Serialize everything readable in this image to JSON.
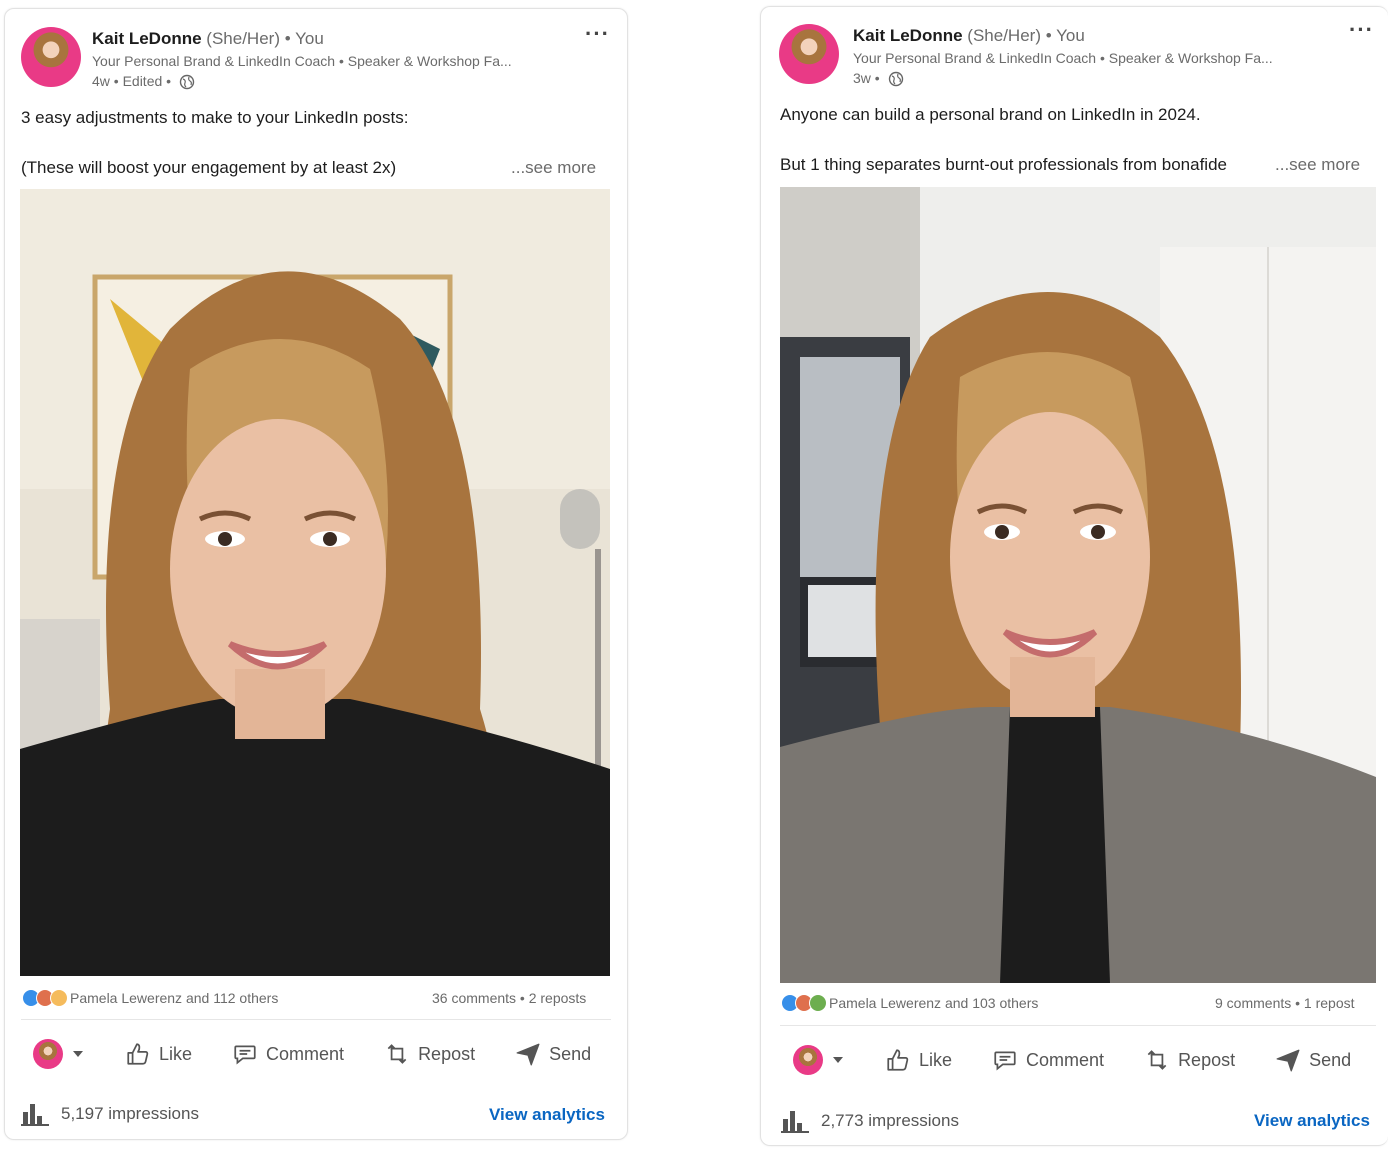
{
  "posts": [
    {
      "author": "Kait LeDonne",
      "pronouns": "(She/Her)",
      "relation": "• You",
      "headline": "Your Personal Brand & LinkedIn Coach • Speaker & Workshop Fa...",
      "timestamp": "4w • Edited •",
      "text_line1": "3 easy adjustments to make to your LinkedIn posts:",
      "text_line2": "(These will boost your engagement by at least 2x)",
      "see_more": "...see more",
      "reactions": "Pamela Lewerenz and 112 others",
      "counts": "36 comments • 2 reposts",
      "actions": [
        "Like",
        "Comment",
        "Repost",
        "Send"
      ],
      "impressions": "5,197 impressions",
      "analytics": "View analytics",
      "reaction_colors": [
        "#378fe9",
        "#df704d",
        "#f5bb5c"
      ],
      "photo_top_color": "#a8743e",
      "photo_wall_color": "#e9e3d6",
      "photo_clothing_color": "#1c1c1c"
    },
    {
      "author": "Kait LeDonne",
      "pronouns": "(She/Her)",
      "relation": "• You",
      "headline": "Your Personal Brand & LinkedIn Coach • Speaker & Workshop Fa...",
      "timestamp": "3w •",
      "text_line1": "Anyone can build a personal brand on LinkedIn in 2024.",
      "text_line2": "But 1 thing separates burnt-out professionals from bonafide",
      "see_more": "...see more",
      "reactions": "Pamela Lewerenz and 103 others",
      "counts": "9 comments • 1 repost",
      "actions": [
        "Like",
        "Comment",
        "Repost",
        "Send"
      ],
      "impressions": "2,773 impressions",
      "analytics": "View analytics",
      "reaction_colors": [
        "#378fe9",
        "#df704d",
        "#6dae4f"
      ],
      "photo_top_color": "#a8743e",
      "photo_wall_color": "#eeeeec",
      "photo_clothing_color": "#7a7671"
    }
  ],
  "icons": {
    "more": "more-icon",
    "globe": "globe-icon",
    "like": "like-icon",
    "comment": "comment-icon",
    "repost": "repost-icon",
    "send": "send-icon",
    "chart": "bar-chart-icon"
  },
  "colors": {
    "link": "#0a66c2",
    "muted": "#6b6b6b",
    "text": "#1d1d1d"
  }
}
